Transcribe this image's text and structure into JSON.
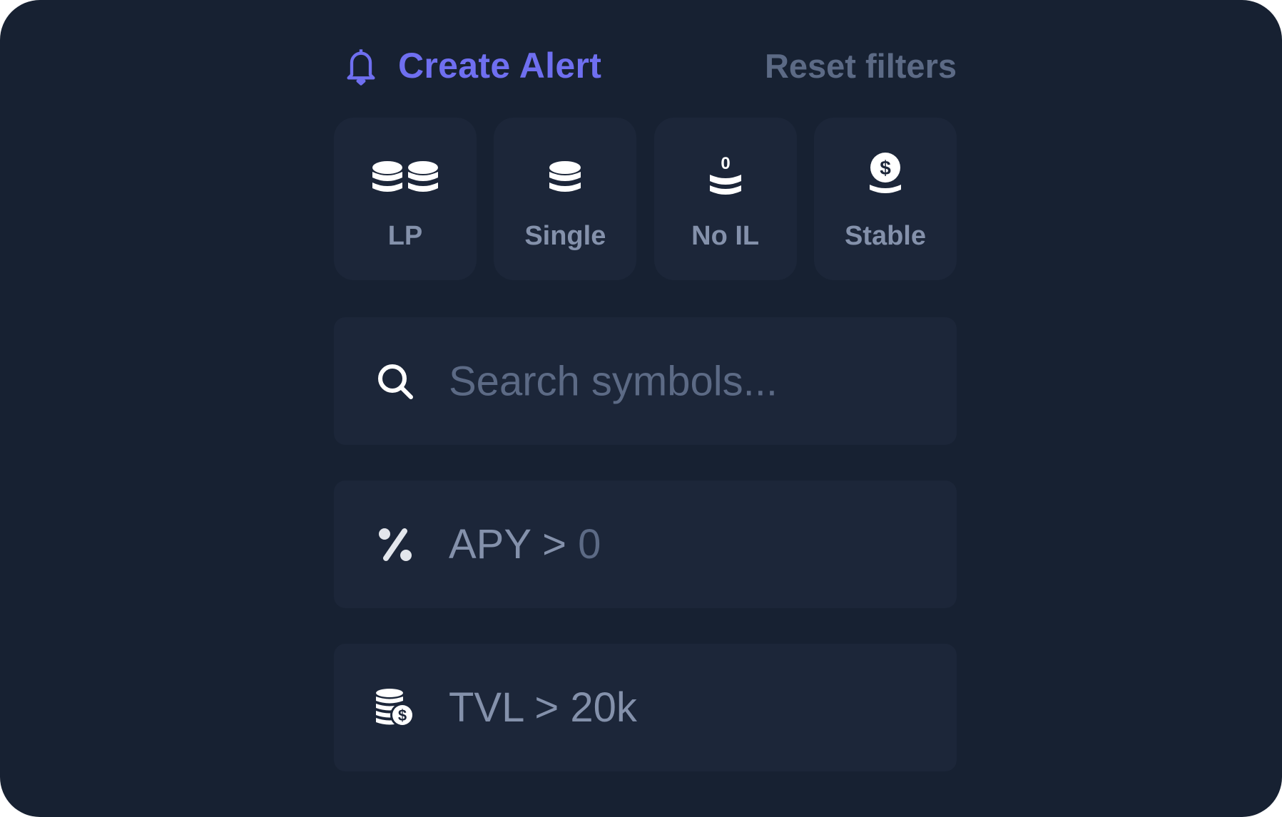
{
  "header": {
    "create_alert_label": "Create Alert",
    "create_alert_icon": "bell-icon",
    "reset_filters_label": "Reset filters"
  },
  "colors": {
    "background": "#172132",
    "surface": "#1c2639",
    "accent": "#6f6ff0",
    "muted_text": "#5c6a85",
    "label_text": "#8491ab",
    "icon": "#ffffff"
  },
  "filter_tiles": [
    {
      "label": "LP",
      "icon": "double-coin-stack-icon"
    },
    {
      "label": "Single",
      "icon": "coin-stack-icon"
    },
    {
      "label": "No IL",
      "icon": "zero-coin-stack-icon"
    },
    {
      "label": "Stable",
      "icon": "dollar-coin-stack-icon"
    }
  ],
  "search": {
    "icon": "search-icon",
    "value": "",
    "placeholder": "Search symbols..."
  },
  "apy_filter": {
    "icon": "percent-icon",
    "label": "APY",
    "operator": ">",
    "value": "0"
  },
  "tvl_filter": {
    "icon": "coins-dollar-icon",
    "label": "TVL",
    "operator": ">",
    "value": "20k"
  }
}
